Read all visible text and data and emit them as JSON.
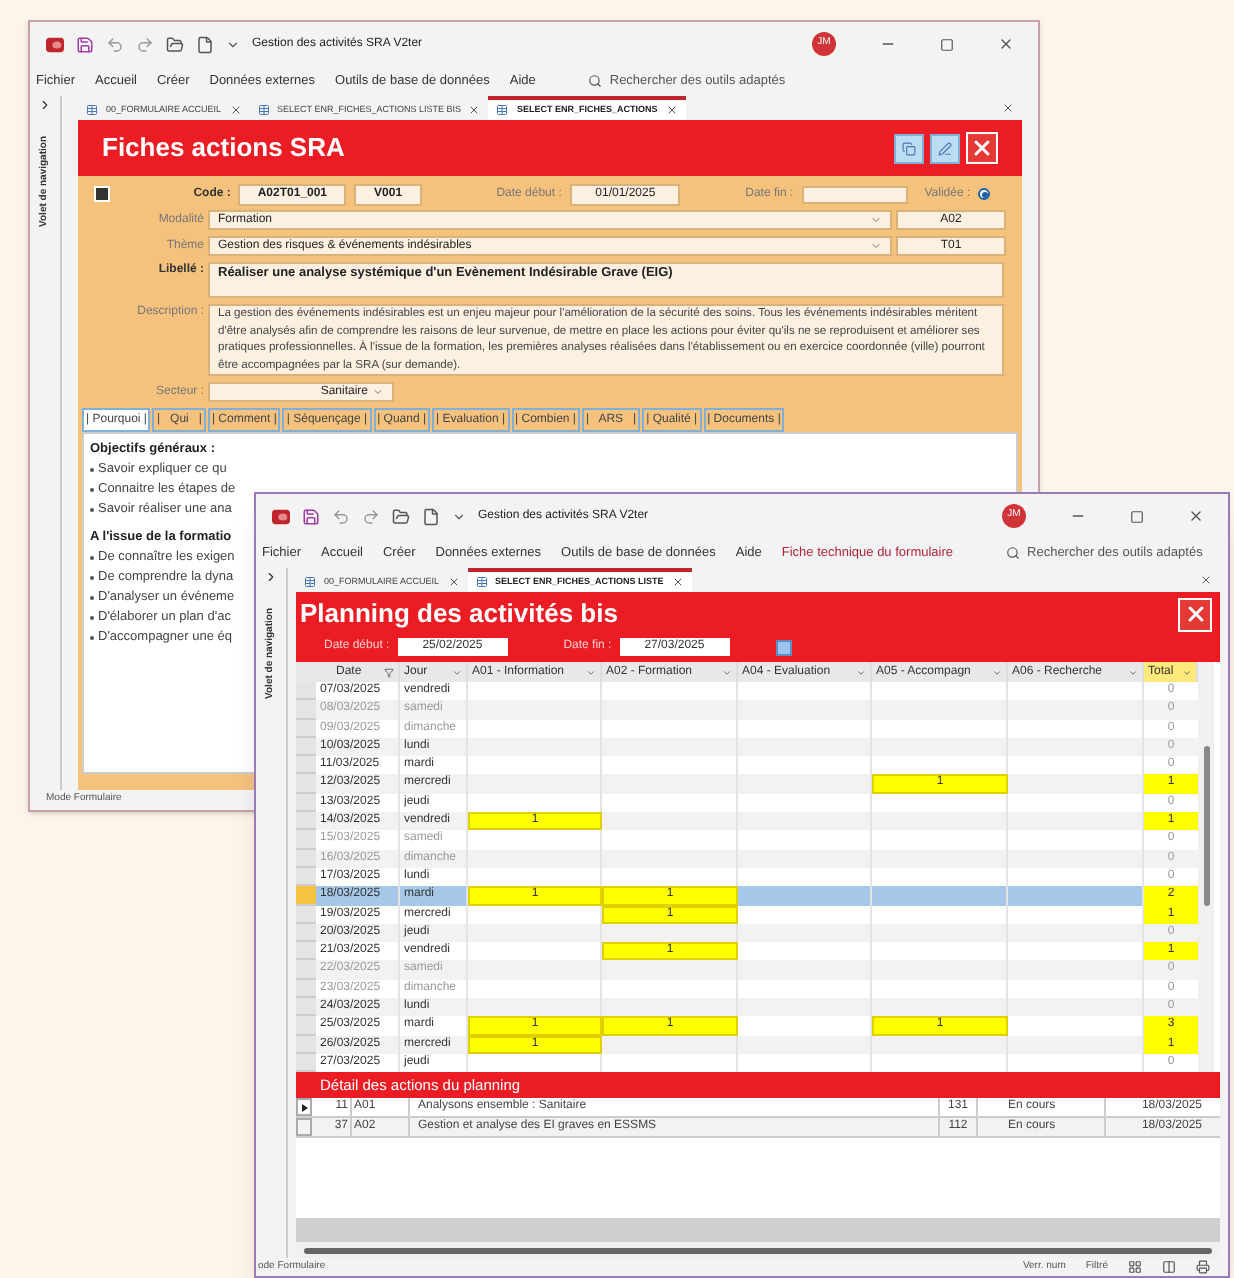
{
  "back_window": {
    "title": "Gestion des activités SRA V2ter",
    "avatar": "JM",
    "menu": [
      {
        "label": "Fichier",
        "kind": "menu"
      },
      {
        "label": "Accueil",
        "kind": "menu"
      },
      {
        "label": "Créer",
        "kind": "menu"
      },
      {
        "label": "Données externes",
        "kind": "menu"
      },
      {
        "label": "Outils de base de données",
        "kind": "menu"
      },
      {
        "label": "Aide",
        "kind": "menu"
      }
    ],
    "search": "Rechercher des outils adaptés",
    "tabs": [
      {
        "label": "00_FORMULAIRE ACCUEIL",
        "selected": false
      },
      {
        "label": "SELECT ENR_FICHES_ACTIONS LISTE BIS",
        "selected": false
      },
      {
        "label": "SELECT ENR_FICHES_ACTIONS",
        "selected": true
      }
    ],
    "navigation_pane": "Volet de navigation",
    "form": {
      "title": "Fiches actions SRA",
      "code_label": "Code :",
      "code": "A02T01_001",
      "version": "V001",
      "date_debut_label": "Date début :",
      "date_debut": "01/01/2025",
      "date_fin_label": "Date fin :",
      "validee_label": "Validée :",
      "validee": true,
      "modalite_label": "Modalité",
      "modalite": "Formation",
      "modalite_code": "A02",
      "theme_label": "Thème",
      "theme": "Gestion des risques & événements indésirables",
      "theme_code": "T01",
      "libelle_label": "Libellé :",
      "libelle": "Réaliser une analyse systémique d'un Evènement Indésirable Grave (EIG)",
      "description_label": "Description :",
      "description": "La gestion des événements indésirables est un enjeu majeur pour l'amélioration de la sécurité des soins. Tous les événements indésirables méritent d'être analysés afin de comprendre les raisons de leur survenue, de mettre en place les actions pour éviter qu'ils ne se reproduisent et améliorer ses pratiques professionnelles. À l'issue de la formation, les premières analyses réalisées dans l'établissement ou en exercice coordonnée (ville) pourront être accompagnées par la SRA (sur demande).",
      "secteur_label": "Secteur :",
      "secteur": "Sanitaire",
      "subtabs": [
        {
          "label": "| Pourquoi |",
          "selected": true
        },
        {
          "label": "|   Qui   |",
          "selected": false
        },
        {
          "label": "| Comment |",
          "selected": false
        },
        {
          "label": "| Séquençage |",
          "selected": false
        },
        {
          "label": "| Quand |",
          "selected": false
        },
        {
          "label": "| Evaluation |",
          "selected": false
        },
        {
          "label": "| Combien |",
          "selected": false
        },
        {
          "label": "|   ARS   |",
          "selected": false
        },
        {
          "label": "| Qualité |",
          "selected": false
        },
        {
          "label": "| Documents |",
          "selected": false
        }
      ],
      "content": [
        {
          "kind": "heading",
          "text": "Objectifs généraux :"
        },
        {
          "kind": "bullet",
          "text": "Savoir expliquer ce qu"
        },
        {
          "kind": "bullet",
          "text": "Connaitre les étapes de"
        },
        {
          "kind": "bullet",
          "text": "Savoir réaliser une ana"
        },
        {
          "kind": "heading",
          "text": "A l'issue de la formatio"
        },
        {
          "kind": "bullet",
          "text": "De connaître les exigen"
        },
        {
          "kind": "bullet",
          "text": "De comprendre la dyna"
        },
        {
          "kind": "bullet",
          "text": "D'analyser un événeme"
        },
        {
          "kind": "bullet",
          "text": "D'élaborer un plan d'ac"
        },
        {
          "kind": "bullet",
          "text": "D'accompagner une éq"
        }
      ]
    },
    "status_bar": "Mode Formulaire"
  },
  "front_window": {
    "title": "Gestion des activités SRA V2ter",
    "avatar": "JM",
    "menu": [
      {
        "label": "Fichier",
        "kind": "menu"
      },
      {
        "label": "Accueil",
        "kind": "menu"
      },
      {
        "label": "Créer",
        "kind": "menu"
      },
      {
        "label": "Données externes",
        "kind": "menu"
      },
      {
        "label": "Outils de base de données",
        "kind": "menu"
      },
      {
        "label": "Aide",
        "kind": "menu"
      },
      {
        "label": "Fiche technique du formulaire",
        "kind": "contextual"
      }
    ],
    "search": "Rechercher des outils adaptés",
    "tabs": [
      {
        "label": "00_FORMULAIRE ACCUEIL",
        "selected": false
      },
      {
        "label": "SELECT ENR_FICHES_ACTIONS LISTE",
        "selected": true
      }
    ],
    "navigation_pane": "Volet de navigation",
    "form": {
      "title": "Planning des activités bis",
      "date_debut_label": "Date début :",
      "date_debut": "25/02/2025",
      "date_fin_label": "Date fin :",
      "date_fin": "27/03/2025",
      "columns": [
        "Date",
        "Jour",
        "A01 - Information",
        "A02 - Formation",
        "A04 - Evaluation",
        "A05 - Accompagn",
        "A06 - Recherche",
        "Total"
      ],
      "rows": [
        {
          "cells": [
            "07/03/2025",
            "vendredi",
            "",
            "",
            "",
            "",
            "",
            "0"
          ],
          "weekend": false,
          "selected": false,
          "active": false
        },
        {
          "cells": [
            "08/03/2025",
            "samedi",
            "",
            "",
            "",
            "",
            "",
            "0"
          ],
          "weekend": true,
          "selected": false,
          "active": false
        },
        {
          "cells": [
            "09/03/2025",
            "dimanche",
            "",
            "",
            "",
            "",
            "",
            "0"
          ],
          "weekend": true,
          "selected": false,
          "active": false
        },
        {
          "cells": [
            "10/03/2025",
            "lundi",
            "",
            "",
            "",
            "",
            "",
            "0"
          ],
          "weekend": false,
          "selected": false,
          "active": false
        },
        {
          "cells": [
            "11/03/2025",
            "mardi",
            "",
            "",
            "",
            "",
            "",
            "0"
          ],
          "weekend": false,
          "selected": false,
          "active": false
        },
        {
          "cells": [
            "12/03/2025",
            "mercredi",
            "",
            "",
            "",
            "1",
            "",
            "1"
          ],
          "weekend": false,
          "selected": false,
          "active": true
        },
        {
          "cells": [
            "13/03/2025",
            "jeudi",
            "",
            "",
            "",
            "",
            "",
            "0"
          ],
          "weekend": false,
          "selected": false,
          "active": false
        },
        {
          "cells": [
            "14/03/2025",
            "vendredi",
            "1",
            "",
            "",
            "",
            "",
            "1"
          ],
          "weekend": false,
          "selected": false,
          "active": true
        },
        {
          "cells": [
            "15/03/2025",
            "samedi",
            "",
            "",
            "",
            "",
            "",
            "0"
          ],
          "weekend": true,
          "selected": false,
          "active": false
        },
        {
          "cells": [
            "16/03/2025",
            "dimanche",
            "",
            "",
            "",
            "",
            "",
            "0"
          ],
          "weekend": true,
          "selected": false,
          "active": false
        },
        {
          "cells": [
            "17/03/2025",
            "lundi",
            "",
            "",
            "",
            "",
            "",
            "0"
          ],
          "weekend": false,
          "selected": false,
          "active": false
        },
        {
          "cells": [
            "18/03/2025",
            "mardi",
            "1",
            "1",
            "",
            "",
            "",
            "2"
          ],
          "weekend": false,
          "selected": true,
          "active": true
        },
        {
          "cells": [
            "19/03/2025",
            "mercredi",
            "",
            "1",
            "",
            "",
            "",
            "1"
          ],
          "weekend": false,
          "selected": false,
          "active": true
        },
        {
          "cells": [
            "20/03/2025",
            "jeudi",
            "",
            "",
            "",
            "",
            "",
            "0"
          ],
          "weekend": false,
          "selected": false,
          "active": false
        },
        {
          "cells": [
            "21/03/2025",
            "vendredi",
            "",
            "1",
            "",
            "",
            "",
            "1"
          ],
          "weekend": false,
          "selected": false,
          "active": true
        },
        {
          "cells": [
            "22/03/2025",
            "samedi",
            "",
            "",
            "",
            "",
            "",
            "0"
          ],
          "weekend": true,
          "selected": false,
          "active": false
        },
        {
          "cells": [
            "23/03/2025",
            "dimanche",
            "",
            "",
            "",
            "",
            "",
            "0"
          ],
          "weekend": true,
          "selected": false,
          "active": false
        },
        {
          "cells": [
            "24/03/2025",
            "lundi",
            "",
            "",
            "",
            "",
            "",
            "0"
          ],
          "weekend": false,
          "selected": false,
          "active": false
        },
        {
          "cells": [
            "25/03/2025",
            "mardi",
            "1",
            "1",
            "",
            "1",
            "",
            "3"
          ],
          "weekend": false,
          "selected": false,
          "active": true
        },
        {
          "cells": [
            "26/03/2025",
            "mercredi",
            "1",
            "",
            "",
            "",
            "",
            "1"
          ],
          "weekend": false,
          "selected": false,
          "active": true
        },
        {
          "cells": [
            "27/03/2025",
            "jeudi",
            "",
            "",
            "",
            "",
            "",
            "0"
          ],
          "weekend": false,
          "selected": false,
          "active": false
        }
      ],
      "detail_title": "Détail des actions du planning",
      "detail_rows": [
        {
          "selected": true,
          "id": "11",
          "code": "A01",
          "label": "Analysons ensemble : Sanitaire",
          "number": "131",
          "status": "En cours",
          "date": "18/03/2025"
        },
        {
          "selected": false,
          "id": "37",
          "code": "A02",
          "label": "Gestion et analyse des EI graves en ESSMS",
          "number": "112",
          "status": "En cours",
          "date": "18/03/2025"
        }
      ]
    },
    "status_bar": "ode Formulaire",
    "status_indicators": [
      "Verr. num",
      "Filtré"
    ]
  }
}
